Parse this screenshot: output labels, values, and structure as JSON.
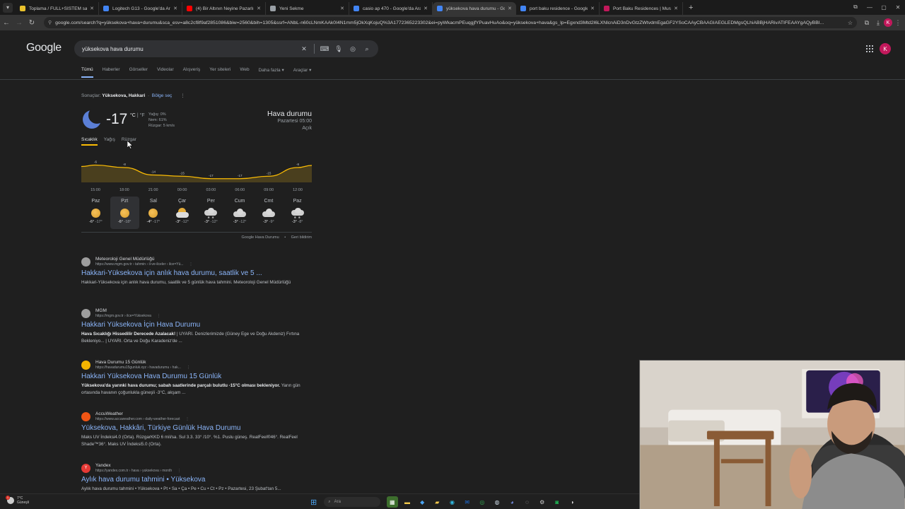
{
  "browser": {
    "tabs": [
      {
        "title": "Toplama / FULL+SİSTEM sahibi",
        "color": "#e9c12c",
        "active": false
      },
      {
        "title": "Logitech G13 - Google'da Ara",
        "color": "#4285f4",
        "active": false
      },
      {
        "title": "(4) Bir Altının Neyine Pazarlık Y",
        "color": "#ff0000",
        "active": false
      },
      {
        "title": "Yeni Sekme",
        "color": "#9aa0a6",
        "active": false
      },
      {
        "title": "casio ap 470 - Google'da Ara",
        "color": "#4285f4",
        "active": false
      },
      {
        "title": "yüksekova hava durumu - Goog",
        "color": "#4285f4",
        "active": true
      },
      {
        "title": "port baku residence - Google'd",
        "color": "#4285f4",
        "active": false
      },
      {
        "title": "Port Baku Residences | Muradh",
        "color": "#c2185b",
        "active": false
      }
    ],
    "url": "google.com/search?q=yüksekova+hava+durumu&sca_esv=a8c2cf8f9af2851086&biw=2560&bih=1305&ssrf=ANbL-n60cLNmKAAk0I4N1mm5jOkXqKojuQ%3A1772365223302&ei=pyWkacmPEuqgjfYPuavHuAo&oq=yüksekova+hava&gs_lp=Egxnd3Mtd2l6LXNlcnAiD3nDvGtzZWtvdmEgaGF2YSoCAAyCBAAGIAEGLEDMgsQLhiABBjHARivATIFEAAYgAQyBBI...",
    "avatar": "K"
  },
  "google": {
    "logo": "Google",
    "query": "yüksekova hava durumu",
    "tabs": [
      "Tümü",
      "Haberler",
      "Görseller",
      "Videolar",
      "Alışveriş",
      "Yer siteleri",
      "Web",
      "Daha fazla ▾",
      "Araçlar ▾"
    ],
    "avatar": "K"
  },
  "weather": {
    "results_prefix": "Sonuçlar:",
    "location": "Yüksekova, Hakkari",
    "region_link": "Bölge seç",
    "temp": "-17",
    "unit_c": "°C",
    "unit_sep": "|",
    "unit_f": "°F",
    "precip": "Yağış: 0%",
    "humidity": "Nem: 61%",
    "wind": "Rüzgar: 5 km/s",
    "title": "Hava durumu",
    "time": "Pazartesi 05:00",
    "condition": "Açık",
    "tabs": [
      "Sıcaklık",
      "Yağış",
      "Rüzgar"
    ],
    "footer_source": "Google Hava Durumu",
    "footer_feedback": "Geri bildirim",
    "days": [
      {
        "name": "Paz",
        "icon": "sun",
        "high": "-6°",
        "low": "-17°",
        "active": false
      },
      {
        "name": "Pzt",
        "icon": "sun",
        "high": "-6°",
        "low": "-18°",
        "active": true
      },
      {
        "name": "Sal",
        "icon": "sun",
        "high": "-4°",
        "low": "-17°",
        "active": false
      },
      {
        "name": "Çar",
        "icon": "partly-cloudy",
        "high": "-3°",
        "low": "-12°",
        "active": false
      },
      {
        "name": "Per",
        "icon": "snow",
        "high": "-3°",
        "low": "-12°",
        "active": false
      },
      {
        "name": "Cum",
        "icon": "cloud",
        "high": "-3°",
        "low": "-12°",
        "active": false
      },
      {
        "name": "Cmt",
        "icon": "cloud",
        "high": "-3°",
        "low": "-9°",
        "active": false
      },
      {
        "name": "Paz",
        "icon": "snow",
        "high": "-3°",
        "low": "-8°",
        "active": false
      }
    ]
  },
  "chart_data": {
    "type": "area",
    "x": [
      "15:00",
      "18:00",
      "21:00",
      "00:00",
      "03:00",
      "06:00",
      "09:00",
      "12:00"
    ],
    "values": [
      -6,
      -8,
      -14,
      -15,
      -17,
      -17,
      -15,
      -8
    ],
    "labels": [
      "-6",
      "-8",
      "-14",
      "-15",
      "-17",
      "-17",
      "-15",
      "-8"
    ],
    "color": "#fbbc04",
    "ylim": [
      -20,
      -4
    ]
  },
  "results": [
    {
      "site": "Meteoroloji Genel Müdürlüğü",
      "url": "https://www.mgm.gov.tr › tahmin › il-ve-ilceler › ilce=Yü...",
      "title": "Hakkari-Yüksekova için anlık hava durumu, saatlik ve 5 ...",
      "snippet": "Hakkari-Yüksekova için anlık hava durumu, saatlik ve 5 günlük hava tahmini. Meteoroloji Genel Müdürlüğü",
      "snippet_bold": "",
      "fav_color": "#9e9e9e",
      "fav_text": ""
    },
    {
      "site": "MGM",
      "url": "https://mgm.gov.tr › ilce=Yüksekova",
      "title": "Hakkari Yüksekova İçin Hava Durumu",
      "snippet_bold": "Hava Sıcaklığı Hissedilir Derecede Azalacak!",
      "snippet": " | UYARI. Denizlerimizde (Güney Ege ve Doğu Akdeniz) Fırtına Bekleniyo... | UYARI. Orta ve Doğu Karadeniz'de ...",
      "fav_color": "#9e9e9e",
      "fav_text": ""
    },
    {
      "site": "Hava Durumu 15 Günlük",
      "url": "https://havadurumu15gunluk.xyz › havadurumu › hak...",
      "title": "Hakkari Yüksekova Hava Durumu 15 Günlük",
      "snippet_bold": "Yüksekova'da yarınki hava durumu; sabah saatlerinde parçalı bulutlu -15°C olması bekleniyor.",
      "snippet": " Yarın gün ortasında havanın çoğunlukla güneşli -3°C, akşam ...",
      "fav_color": "#f4b400",
      "fav_text": ""
    },
    {
      "site": "AccuWeather",
      "url": "https://www.accuweather.com › daily-weather-forecast",
      "title": "Yüksekova, Hakkâri, Türkiye Günlük Hava Durumu",
      "snippet_bold": "",
      "snippet": "Maks UV İndeksi4.0 (Orta). RüzgarKKD 6 mil/sa. Sul 3.3. 33° /10°. %1. Puslu güneş. RealFeel®46°. RealFeel Shade™36°. Maks UV İndeksi5.0 (Orta).",
      "fav_color": "#f05514",
      "fav_text": ""
    },
    {
      "site": "Yandex",
      "url": "https://yandex.com.tr › hava › yuksekova › month",
      "title": "Aylık hava durumu tahmini • Yüksekova",
      "snippet_bold": "",
      "snippet": "Aylık hava durumu tahmini • Yüksekova • Pt • Sa • Ça • Pe • Cu • Ct • Pz • Pazartesi, 23 Şubat'tan 5...",
      "fav_color": "#e53935",
      "fav_text": "Y"
    }
  ],
  "taskbar": {
    "weather_temp": "7°C",
    "weather_cond": "Güneşli",
    "badge": "1",
    "search_placeholder": "Ara"
  }
}
